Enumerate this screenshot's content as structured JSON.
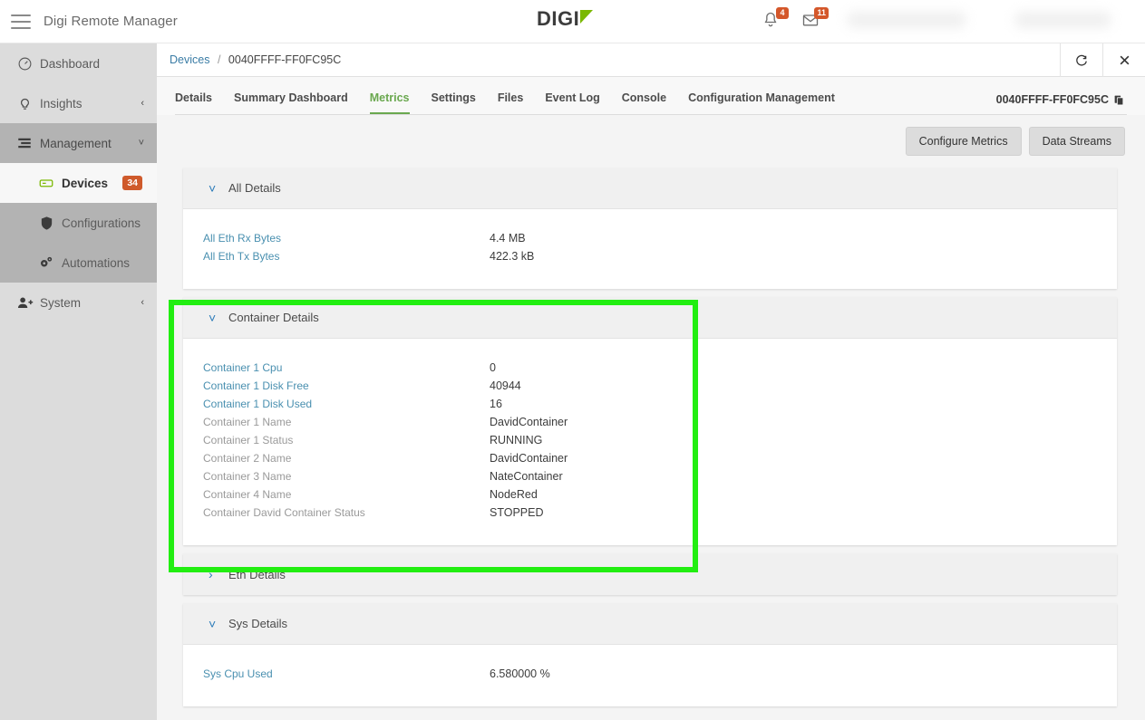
{
  "header": {
    "menu_icon": "hamburger-icon",
    "app_title": "Digi Remote Manager",
    "logo_text": "DIGI",
    "notifications": {
      "icon": "bell-icon",
      "count": "4"
    },
    "messages": {
      "icon": "envelope-icon",
      "count": "11"
    }
  },
  "sidebar": {
    "items": [
      {
        "label": "Dashboard",
        "icon": "gauge-icon",
        "level": 1,
        "state": "normal",
        "chevron": "",
        "badge": ""
      },
      {
        "label": "Insights",
        "icon": "lightbulb-icon",
        "level": 1,
        "state": "normal",
        "chevron": "‹",
        "badge": ""
      },
      {
        "label": "Management",
        "icon": "list-icon",
        "level": 1,
        "state": "group-open",
        "chevron": "˅",
        "badge": ""
      },
      {
        "label": "Devices",
        "icon": "device-icon",
        "level": 2,
        "state": "active",
        "chevron": "",
        "badge": "34"
      },
      {
        "label": "Configurations",
        "icon": "shield-icon",
        "level": 2,
        "state": "normal",
        "chevron": "",
        "badge": ""
      },
      {
        "label": "Automations",
        "icon": "gears-icon",
        "level": 2,
        "state": "normal",
        "chevron": "",
        "badge": ""
      },
      {
        "label": "System",
        "icon": "user-add-icon",
        "level": 1,
        "state": "normal",
        "chevron": "‹",
        "badge": ""
      }
    ]
  },
  "breadcrumb": {
    "root": "Devices",
    "separator": "/",
    "current": "0040FFFF-FF0FC95C",
    "refresh_icon": "refresh-icon",
    "close_icon": "close-icon"
  },
  "tabs": [
    {
      "label": "Details",
      "active": false
    },
    {
      "label": "Summary Dashboard",
      "active": false
    },
    {
      "label": "Metrics",
      "active": true
    },
    {
      "label": "Settings",
      "active": false
    },
    {
      "label": "Files",
      "active": false
    },
    {
      "label": "Event Log",
      "active": false
    },
    {
      "label": "Console",
      "active": false
    },
    {
      "label": "Configuration Management",
      "active": false
    }
  ],
  "device_id": "0040FFFF-FF0FC95C",
  "device_id_copy_icon": "copy-icon",
  "toolbar": {
    "configure_metrics_label": "Configure Metrics",
    "data_streams_label": "Data Streams"
  },
  "panels": [
    {
      "title": "All Details",
      "expanded": true,
      "rows": [
        {
          "label": "All Eth Rx Bytes",
          "value": "4.4 MB",
          "link": true
        },
        {
          "label": "All Eth Tx Bytes",
          "value": "422.3 kB",
          "link": true
        }
      ]
    },
    {
      "title": "Container Details",
      "expanded": true,
      "highlighted": true,
      "rows": [
        {
          "label": "Container 1 Cpu",
          "value": "0",
          "link": true
        },
        {
          "label": "Container 1 Disk Free",
          "value": "40944",
          "link": true
        },
        {
          "label": "Container 1 Disk Used",
          "value": "16",
          "link": true
        },
        {
          "label": "Container 1 Name",
          "value": "DavidContainer",
          "link": false
        },
        {
          "label": "Container 1 Status",
          "value": "RUNNING",
          "link": false
        },
        {
          "label": "Container 2 Name",
          "value": "DavidContainer",
          "link": false
        },
        {
          "label": "Container 3 Name",
          "value": "NateContainer",
          "link": false
        },
        {
          "label": "Container 4 Name",
          "value": "NodeRed",
          "link": false
        },
        {
          "label": "Container David Container Status",
          "value": "STOPPED",
          "link": false
        }
      ]
    },
    {
      "title": "Eth Details",
      "expanded": false,
      "rows": []
    },
    {
      "title": "Sys Details",
      "expanded": true,
      "rows": [
        {
          "label": "Sys Cpu Used",
          "value": "6.580000 %",
          "link": true
        }
      ]
    }
  ],
  "colors": {
    "accent_green": "#6aa84f",
    "highlight_green": "#22ee11",
    "link_blue": "#4a90b0",
    "badge_orange": "#cf5a2b",
    "logo_green": "#7ab800"
  }
}
